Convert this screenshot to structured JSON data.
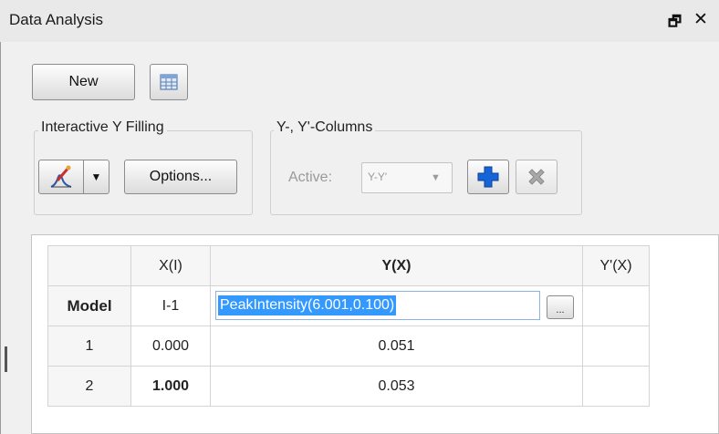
{
  "panel": {
    "title": "Data Analysis",
    "float_icon": "float-window-icon",
    "close_icon": "close-icon"
  },
  "toolbar": {
    "new_label": "New",
    "table_icon": "table-view-icon"
  },
  "interactive_fill": {
    "legend": "Interactive Y Filling",
    "tool_icon": "graph-picker-icon",
    "dropdown_icon": "chevron-down-icon",
    "options_label": "Options..."
  },
  "columns": {
    "legend": "Y-, Y'-Columns",
    "active_label": "Active:",
    "active_value": "Y-Y'",
    "add_icon": "plus-icon",
    "delete_icon": "delete-x-icon"
  },
  "table": {
    "headers": [
      "",
      "X(I)",
      "Y(X)",
      "Y'(X)"
    ],
    "model_row": {
      "label": "Model",
      "x": "I-1",
      "formula": "PeakIntensity(6.001,0.100)",
      "ellipsis": "..."
    },
    "rows": [
      {
        "index": "1",
        "x": "0.000",
        "y": "0.051",
        "dy": ""
      },
      {
        "index": "2",
        "x": "1.000",
        "y": "0.053",
        "dy": ""
      }
    ]
  },
  "colors": {
    "selection": "#3399ff",
    "plus_blue": "#1565d8",
    "delete_gray": "#9a9a9a"
  }
}
